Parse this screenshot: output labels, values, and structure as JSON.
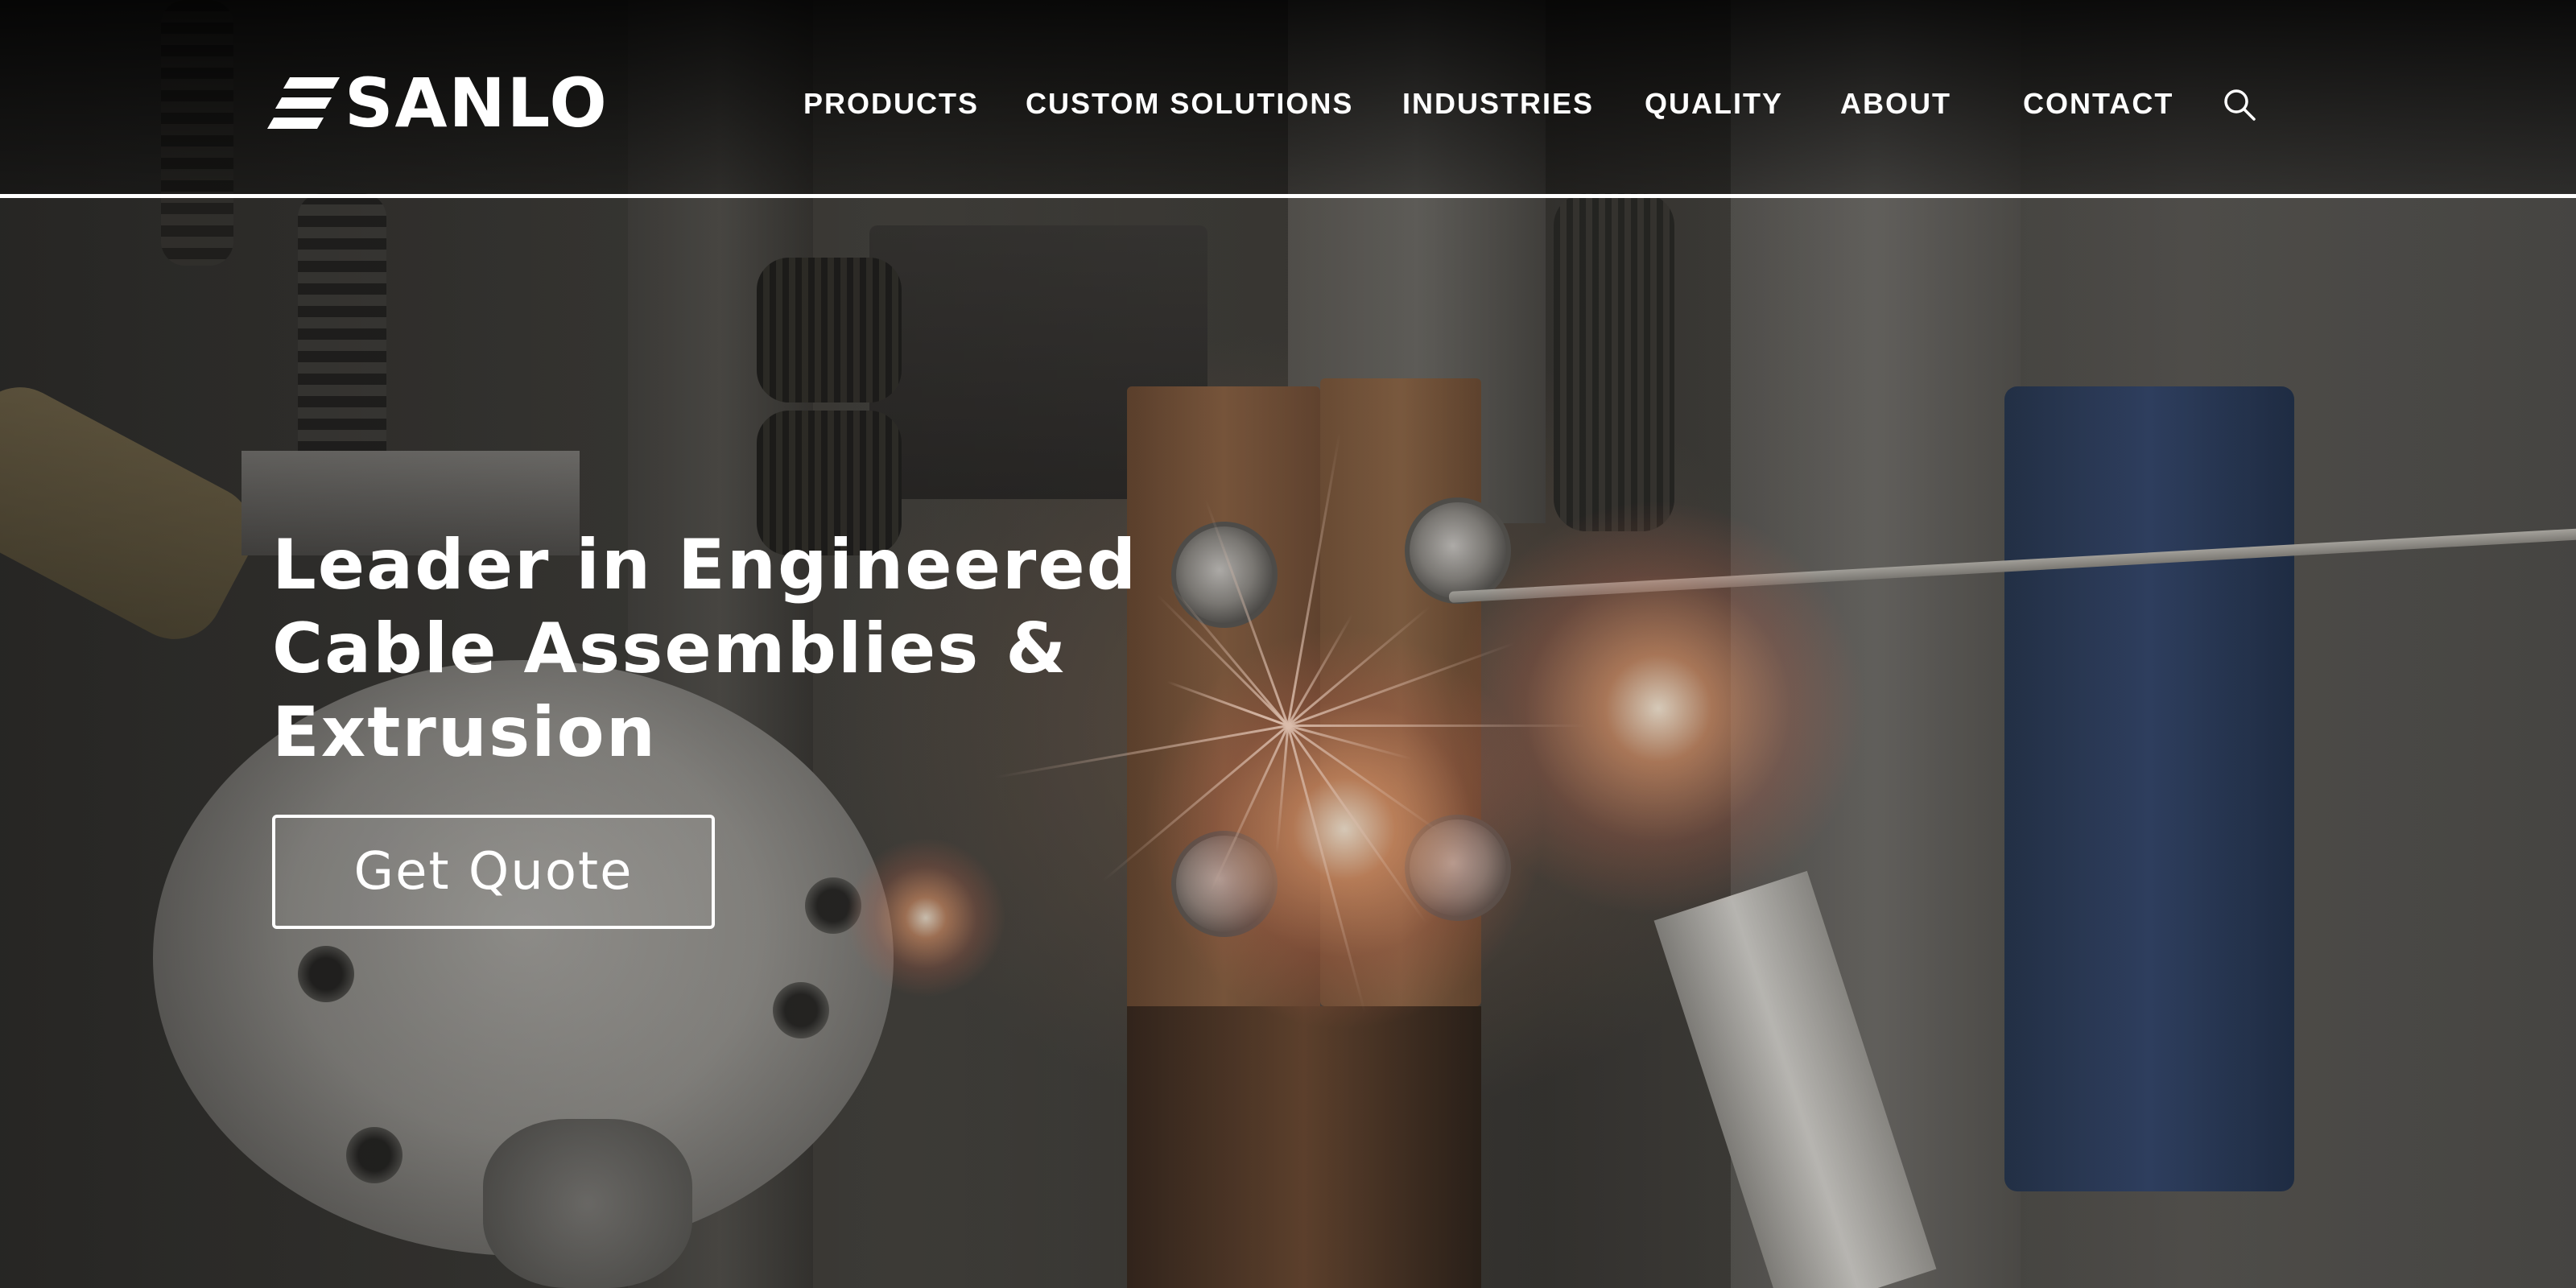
{
  "header": {
    "logo_text": "SANLO",
    "nav_items": [
      {
        "label": "PRODUCTS"
      },
      {
        "label": "CUSTOM SOLUTIONS"
      },
      {
        "label": "INDUSTRIES"
      },
      {
        "label": "QUALITY"
      },
      {
        "label": "ABOUT"
      },
      {
        "label": "CONTACT"
      }
    ],
    "search_icon": "search-icon"
  },
  "hero": {
    "headline_lines": [
      "Leader in Engineered",
      "Cable Assemblies &",
      "Extrusion"
    ],
    "cta_label": "Get Quote",
    "background": "industrial welding machinery with sparks"
  },
  "colors": {
    "text": "#ffffff",
    "header_border": "#ffffff",
    "header_bg": "#000000"
  }
}
